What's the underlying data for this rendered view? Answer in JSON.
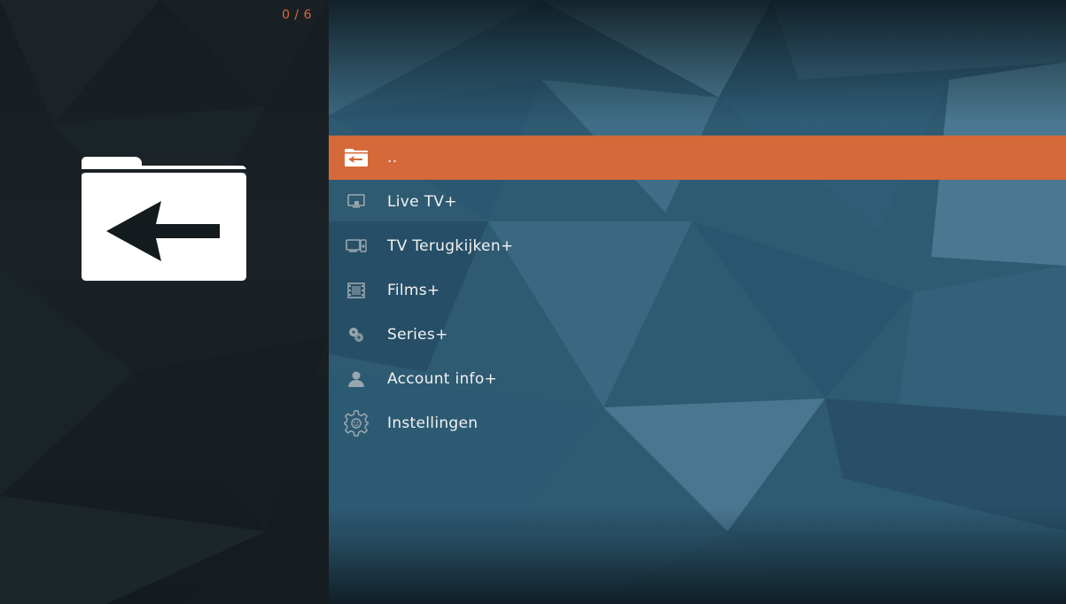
{
  "header": {
    "counter": "0 / 6"
  },
  "thumbnail": {
    "icon": "folder-back-icon"
  },
  "menu": {
    "items": [
      {
        "label": "..",
        "icon": "folder-back-icon",
        "selected": true
      },
      {
        "label": "Live TV+",
        "icon": "tv-icon",
        "selected": false
      },
      {
        "label": "TV Terugkijken+",
        "icon": "tv-replay-icon",
        "selected": false
      },
      {
        "label": "Films+",
        "icon": "film-icon",
        "selected": false
      },
      {
        "label": "Series+",
        "icon": "series-icon",
        "selected": false
      },
      {
        "label": "Account info+",
        "icon": "user-icon",
        "selected": false
      },
      {
        "label": "Instellingen",
        "icon": "gear-icon",
        "selected": false
      }
    ]
  },
  "colors": {
    "accent": "#d6693a",
    "counter_text": "#d8693a",
    "text": "#f2f2f2"
  }
}
